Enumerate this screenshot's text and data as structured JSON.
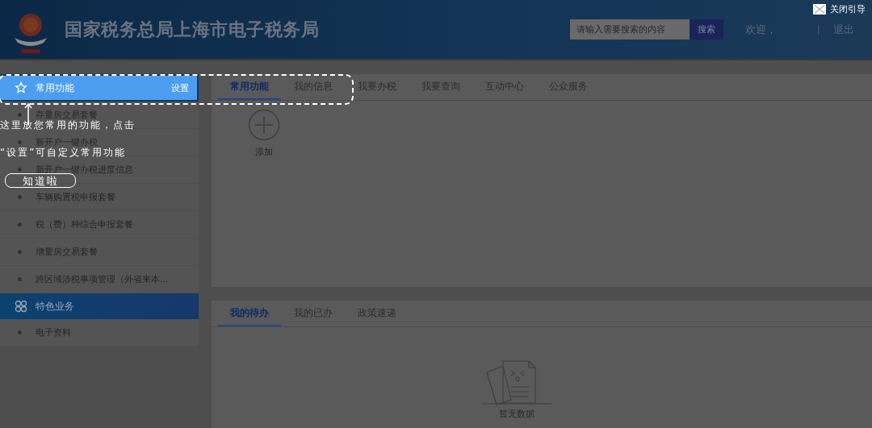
{
  "guide": {
    "close": "关闭引导",
    "tip_lines": [
      "这里放您常用的功能，点击",
      "“设置”可自定义常用功能"
    ],
    "confirm": "知道啦"
  },
  "header": {
    "title": "国家税务总局上海市电子税务局",
    "search": {
      "placeholder": "请输入需要搜索的内容",
      "button": "搜索"
    },
    "greeting": "欢迎，",
    "separator": "|",
    "logout": "退出"
  },
  "sidebar": {
    "sections": [
      {
        "kind": "star",
        "title": "常用功能",
        "action": "设置",
        "highlighted": true,
        "items": [
          "存量房交易套餐",
          "新开户一键办税",
          "新开户一键办税进度信息",
          "车辆购置税申报套餐",
          "税（费）种综合申报套餐",
          "增量房交易套餐",
          "跨区域涉税事项管理（外省来本..."
        ]
      },
      {
        "kind": "grid",
        "title": "特色业务",
        "highlighted": false,
        "items": [
          "电子资料"
        ]
      }
    ]
  },
  "top_panel": {
    "tabs": [
      {
        "label": "常用功能",
        "selected": true
      },
      {
        "label": "我的信息",
        "selected": false
      },
      {
        "label": "我要办税",
        "selected": false
      },
      {
        "label": "我要查询",
        "selected": false
      },
      {
        "label": "互动中心",
        "selected": false
      },
      {
        "label": "公众服务",
        "selected": false
      }
    ],
    "add_label": "添加"
  },
  "bottom_panel": {
    "tabs": [
      {
        "label": "我的待办",
        "selected": true
      },
      {
        "label": "我的已办",
        "selected": false
      },
      {
        "label": "政策速递",
        "selected": false
      }
    ],
    "empty_text": "暂无数据"
  }
}
